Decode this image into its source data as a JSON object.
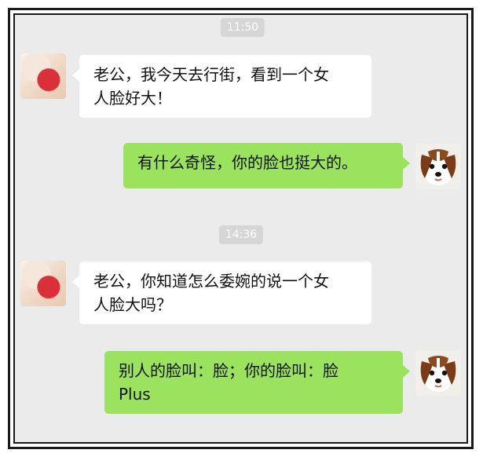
{
  "chat": {
    "timestamps": [
      "11:50",
      "14:36"
    ],
    "messages": [
      {
        "sender": "her",
        "lines": [
          "老公，我今天去行街，看到一个女",
          "人脸好大！"
        ]
      },
      {
        "sender": "him",
        "lines": [
          "有什么奇怪，你的脸也挺大的。"
        ]
      },
      {
        "sender": "her",
        "lines": [
          "老公，你知道怎么委婉的说一个女",
          "人脸大吗？"
        ]
      },
      {
        "sender": "him",
        "lines": [
          "别人的脸叫：脸；你的脸叫：脸",
          "Plus"
        ]
      }
    ]
  },
  "colors": {
    "chat_background": "#ebebeb",
    "incoming_bubble": "#ffffff",
    "outgoing_bubble": "#9be35f",
    "timestamp_bg": "#d6d6d6"
  },
  "icons": {
    "her_avatar": "avatar-rose-icon",
    "his_avatar": "avatar-puppy-icon"
  }
}
